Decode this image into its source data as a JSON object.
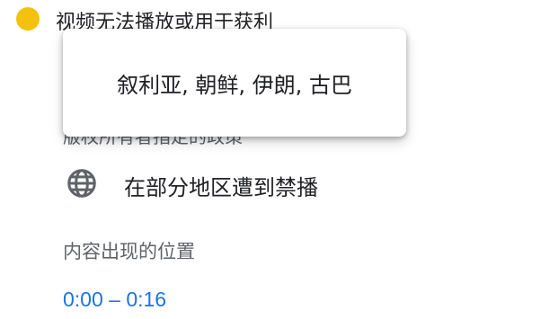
{
  "status": {
    "text": "视频无法播放或用于获利",
    "color": "#f4c20d"
  },
  "policy_text": "版权所有者指定的政策",
  "tooltip": {
    "text": "叙利亚, 朝鲜, 伊朗, 古巴"
  },
  "region": {
    "icon": "globe-icon",
    "text": "在部分地区遭到禁播"
  },
  "location": {
    "label": "内容出现的位置",
    "timestamp": "0:00 – 0:16"
  }
}
